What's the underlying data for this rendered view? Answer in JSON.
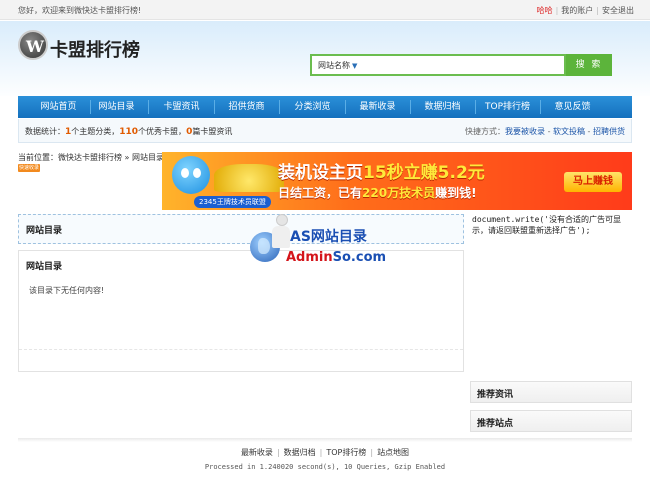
{
  "topbar": {
    "welcome": "您好，欢迎来到微快达卡盟排行榜!",
    "user": "哈哈",
    "my_account": "我的账户",
    "logout": "安全退出"
  },
  "header": {
    "logo_mark": "W",
    "logo_text": "卡盟排行榜"
  },
  "search": {
    "select_value": "网站名称",
    "button_label": "搜 索"
  },
  "nav": {
    "items": [
      "网站首页",
      "网站目录",
      "卡盟资讯",
      "招供货商",
      "分类浏览",
      "最新收录",
      "数据归档",
      "TOP排行榜",
      "意见反馈"
    ]
  },
  "stats": {
    "prefix": "数据统计：",
    "n1": "1",
    "t1": "个主题分类，",
    "n2": "110",
    "t2": "个优秀卡盟，",
    "n3": "0",
    "t3": "篇卡盟资讯",
    "quick_label": "快捷方式：",
    "quick_links": [
      "我要被收录",
      "软文投稿",
      "招聘供货"
    ]
  },
  "breadcrumb": "当前位置：微快达卡盟排行榜 » 网站目录",
  "tag": "快速收录",
  "banner": {
    "line1_a": "装机设主页",
    "line1_b": "15秒立赚5.2元",
    "line2_a": "日结工资，已有",
    "line2_b": "220万技术员",
    "line2_c": "赚到钱!",
    "brand": "2345王牌技术员联盟",
    "cta": "马上赚钱"
  },
  "panel1": {
    "title": "网站目录"
  },
  "panel2": {
    "title": "网站目录",
    "empty": "该目录下无任何内容!"
  },
  "docwrite": "document.write('没有合适的广告可显示，请返回联盟重新选择广告');",
  "watermark": {
    "line1": "AS网站目录",
    "line2_a": "Admin",
    "line2_b": "So.com"
  },
  "sidebar": {
    "news_title": "推荐资讯",
    "sites_title": "推荐站点"
  },
  "footer": {
    "links": [
      "最新收录",
      "数据归档",
      "TOP排行榜",
      "站点地图"
    ],
    "processed": "Processed in 1.240020 second(s), 10 Queries, Gzip Enabled"
  }
}
